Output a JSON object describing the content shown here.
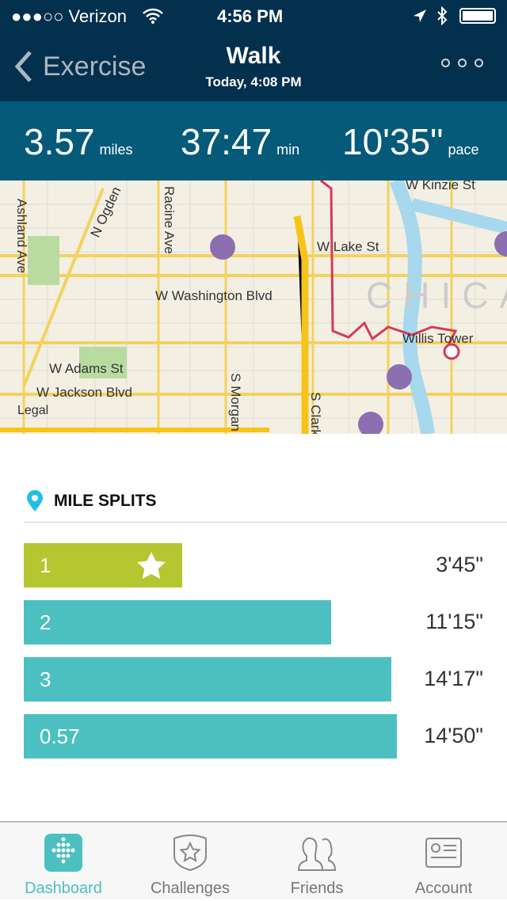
{
  "status_bar": {
    "carrier": "●●●○○ Verizon",
    "time": "4:56 PM"
  },
  "nav": {
    "back_label": "Exercise",
    "title": "Walk",
    "subtitle": "Today, 4:08 PM"
  },
  "stats": [
    {
      "value": "3.57",
      "unit": "miles"
    },
    {
      "value": "37:47",
      "unit": "min"
    },
    {
      "value": "10'35\"",
      "unit": "pace"
    }
  ],
  "map": {
    "labels": [
      "W Kinzie St",
      "W Lake St",
      "W Washington Blvd",
      "W Adams St",
      "W Jackson Blvd",
      "Ashland Ave",
      "N Ogden",
      "Racine Ave",
      "S Morgan",
      "S Clark",
      "Willis Tower",
      "CHICAGO",
      "Legal"
    ]
  },
  "splits": {
    "title": "MILE SPLITS",
    "rows": [
      {
        "label": "1",
        "time": "3'45\"",
        "best": true,
        "color": "#b5c730"
      },
      {
        "label": "2",
        "time": "11'15\"",
        "best": false,
        "color": "#4cc0c0"
      },
      {
        "label": "3",
        "time": "14'17\"",
        "best": false,
        "color": "#4cc0c0"
      },
      {
        "label": "0.57",
        "time": "14'50\"",
        "best": false,
        "color": "#4cc0c0"
      }
    ]
  },
  "tabbar": {
    "items": [
      {
        "label": "Dashboard",
        "active": true
      },
      {
        "label": "Challenges"
      },
      {
        "label": "Friends"
      },
      {
        "label": "Account"
      }
    ],
    "accent": "#4cc0c0"
  }
}
